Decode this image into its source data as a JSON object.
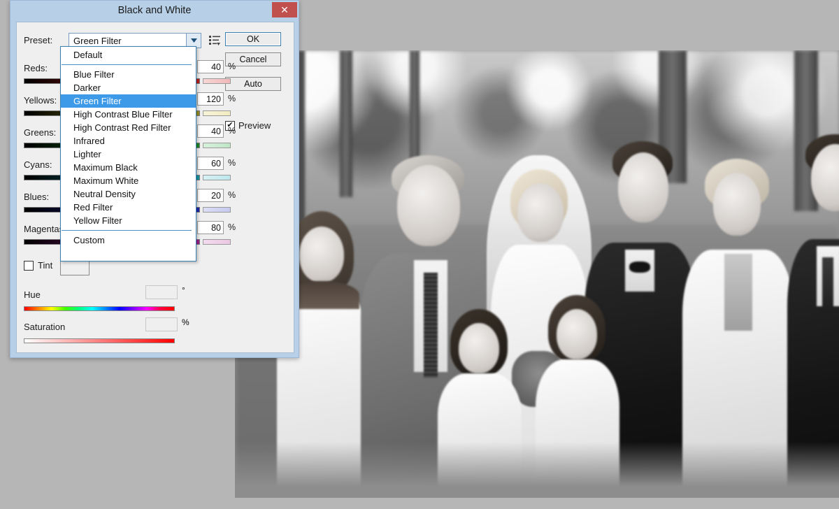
{
  "dialog": {
    "title": "Black and White",
    "close_label": "✕",
    "preset": {
      "label": "Preset:",
      "value": "Green Filter",
      "arrow_icon": "chevron-down-icon",
      "menu_icon": "preset-options-icon",
      "options": [
        "Default",
        "Blue Filter",
        "Darker",
        "Green Filter",
        "High Contrast Blue Filter",
        "High Contrast Red Filter",
        "Infrared",
        "Lighter",
        "Maximum Black",
        "Maximum White",
        "Neutral Density",
        "Red Filter",
        "Yellow Filter",
        "Custom"
      ],
      "selected": "Green Filter"
    },
    "buttons": {
      "ok": "OK",
      "cancel": "Cancel",
      "auto": "Auto"
    },
    "preview": {
      "label": "Preview",
      "checked": true,
      "check_glyph": "✔"
    },
    "channels": [
      {
        "label": "Reds:",
        "value": "40",
        "unit": "%",
        "thumb_pct": 40
      },
      {
        "label": "Yellows:",
        "value": "120",
        "unit": "%",
        "thumb_pct": 93
      },
      {
        "label": "Greens:",
        "value": "40",
        "unit": "%",
        "thumb_pct": 40
      },
      {
        "label": "Cyans:",
        "value": "60",
        "unit": "%",
        "thumb_pct": 55
      },
      {
        "label": "Blues:",
        "value": "20",
        "unit": "%",
        "thumb_pct": 28
      },
      {
        "label": "Magentas:",
        "value": "80",
        "unit": "%",
        "thumb_pct": 62
      }
    ],
    "tint": {
      "label": "Tint",
      "checked": false
    },
    "hue": {
      "label": "Hue",
      "value": "",
      "unit": "°"
    },
    "saturation": {
      "label": "Saturation",
      "value": "",
      "unit": "%"
    }
  },
  "photo": {
    "description": "Black and white wedding group portrait"
  },
  "colors": {
    "titlebar": "#b7d0e8",
    "dialog_face": "#efefef",
    "close_button": "#c0504d",
    "selection": "#3c9ae8",
    "desktop": "#b6b6b6"
  }
}
